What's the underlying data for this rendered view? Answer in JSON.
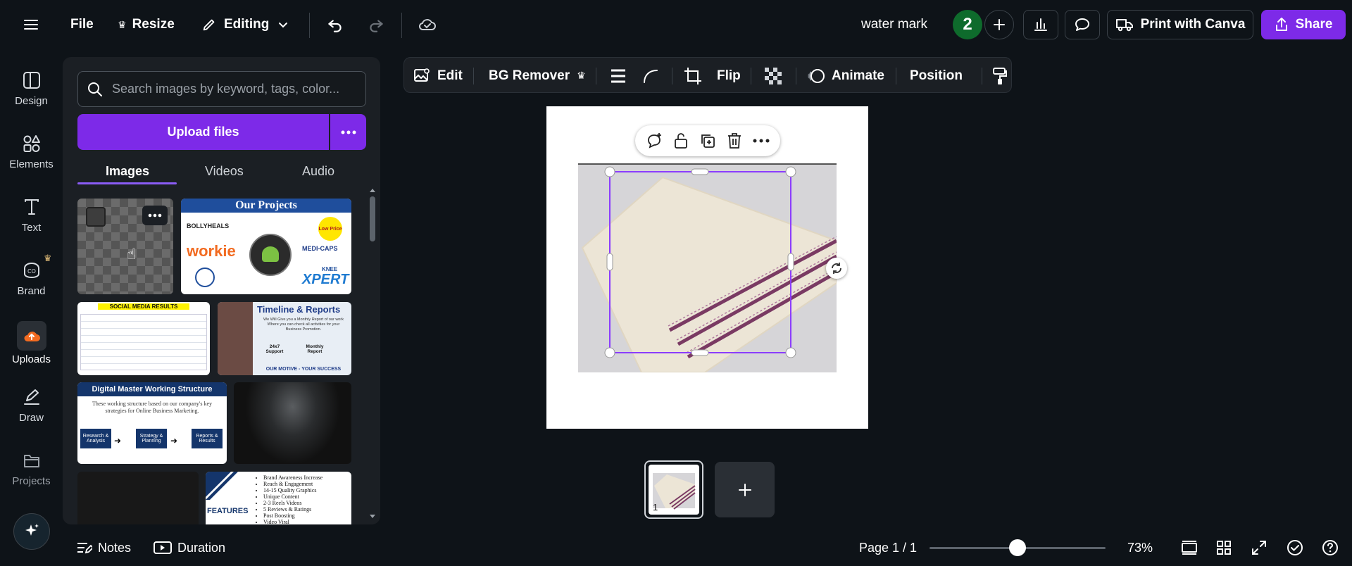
{
  "topbar": {
    "file": "File",
    "resize": "Resize",
    "editing": "Editing",
    "doc_title": "water mark",
    "collaborator_count": "2",
    "print_label": "Print with Canva",
    "share_label": "Share"
  },
  "rail": {
    "items": [
      {
        "label": "Design"
      },
      {
        "label": "Elements"
      },
      {
        "label": "Text"
      },
      {
        "label": "Brand"
      },
      {
        "label": "Uploads"
      },
      {
        "label": "Draw"
      },
      {
        "label": "Projects"
      }
    ]
  },
  "panel": {
    "search_placeholder": "Search images by keyword, tags, color...",
    "upload_label": "Upload files",
    "tabs": [
      "Images",
      "Videos",
      "Audio"
    ],
    "thumbs": {
      "projects_title": "Our Projects",
      "bollyheals": "BOLLYHEALS",
      "workie": "workie",
      "lowprice": "Low Price",
      "medicaps": "MEDI-CAPS",
      "knee": "KNEE",
      "xpert": "XPERT",
      "social_title": "SOCIAL MEDIA RESULTS",
      "timeline_title": "Timeline & Reports",
      "timeline_text": "We Will Give you a Monthly Report of our work Where you can check all activities for your Business Promotion.",
      "support": "24x7 Support",
      "monthly": "Monthly Report",
      "motive": "OUR MOTIVE - YOUR SUCCESS",
      "dm_title": "Digital Master Working Structure",
      "dm_text": "These working structure based on our company's key strategies for Online Business Marketing.",
      "dm_box1": "Research & Analysis",
      "dm_box2": "Strategy & Planning",
      "dm_box3": "Reports & Results",
      "features": "FEATURES",
      "feature_list": [
        "Brand Awareness Increase",
        "Reach & Engagement",
        "14-15 Quality Graphics",
        "Unique Content",
        "2-3 Reels Videos",
        "5 Reviews & Ratings",
        "Post Boosting",
        "Video Viral"
      ]
    }
  },
  "ctxbar": {
    "edit": "Edit",
    "bg_remover": "BG Remover",
    "flip": "Flip",
    "animate": "Animate",
    "position": "Position"
  },
  "pages": {
    "thumb_number": "1"
  },
  "bottombar": {
    "notes": "Notes",
    "duration": "Duration",
    "page_indicator": "Page 1 / 1",
    "zoom": "73%",
    "zoom_fraction": 0.5
  },
  "colors": {
    "accent": "#7d2ae8",
    "selection": "#8b3dff",
    "background": "#0e1318",
    "panel": "#1b1f24"
  }
}
